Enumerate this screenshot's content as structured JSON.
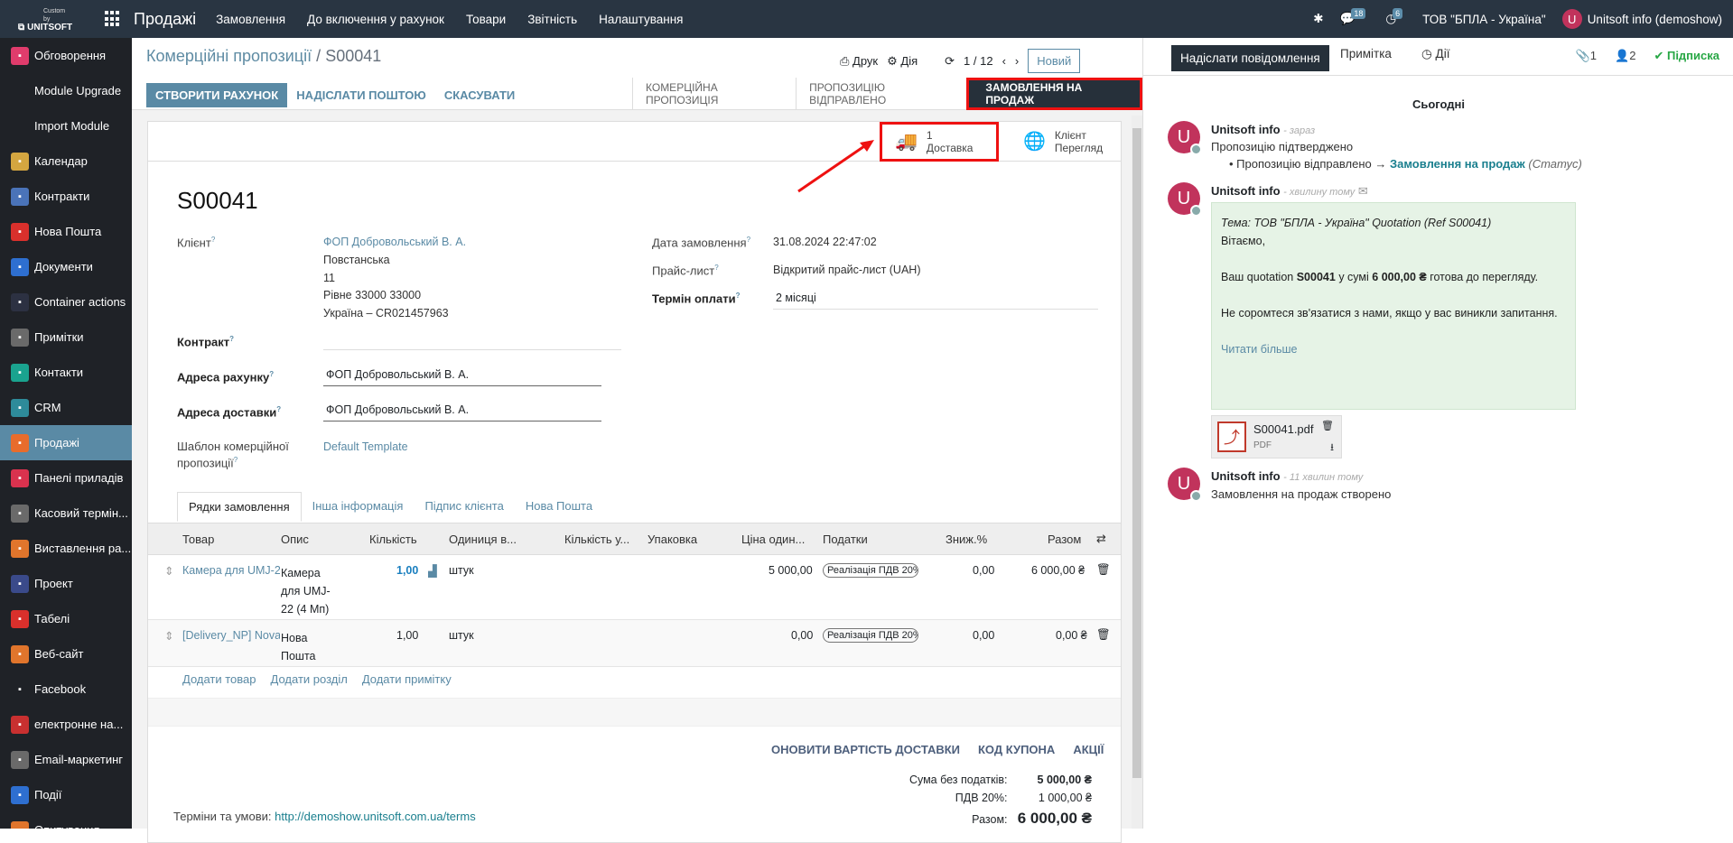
{
  "topbar": {
    "brand_top": "Custom by",
    "brand_name": "UNITSOFT",
    "app_name": "Продажі",
    "menu": [
      "Замовлення",
      "До включення у рахунок",
      "Товари",
      "Звітність",
      "Налаштування"
    ],
    "messages_count": "18",
    "activities_count": "6",
    "company": "ТОВ \"БПЛА - Україна\"",
    "user_initial": "U",
    "user": "Unitsoft info (demoshow)"
  },
  "sidebar": {
    "items": [
      {
        "label": "Обговорення",
        "icon": "chat-icon",
        "color": "#e03c6c"
      },
      {
        "label": "Module Upgrade",
        "icon": "",
        "color": ""
      },
      {
        "label": "Import Module",
        "icon": "",
        "color": ""
      },
      {
        "label": "Календар",
        "icon": "calendar-icon",
        "color": "#d4a640"
      },
      {
        "label": "Контракти",
        "icon": "contract-icon",
        "color": "#4a73b8"
      },
      {
        "label": "Нова Пошта",
        "icon": "nova-poshta-icon",
        "color": "#d9302c"
      },
      {
        "label": "Документи",
        "icon": "documents-icon",
        "color": "#2e6fd0"
      },
      {
        "label": "Container actions",
        "icon": "container-icon",
        "color": "#2c3142"
      },
      {
        "label": "Примітки",
        "icon": "notes-icon",
        "color": "#6a6a6a"
      },
      {
        "label": "Контакти",
        "icon": "contacts-icon",
        "color": "#1aa38f"
      },
      {
        "label": "CRM",
        "icon": "crm-icon",
        "color": "#2e8b9a"
      },
      {
        "label": "Продажі",
        "icon": "sales-icon",
        "color": "#e86c2c"
      },
      {
        "label": "Панелі приладів",
        "icon": "dashboard-icon",
        "color": "#d9324e"
      },
      {
        "label": "Касовий термін...",
        "icon": "pos-icon",
        "color": "#6a6a6a"
      },
      {
        "label": "Виставлення ра...",
        "icon": "invoice-icon",
        "color": "#e0752c"
      },
      {
        "label": "Проект",
        "icon": "project-icon",
        "color": "#3a4a8a"
      },
      {
        "label": "Табелі",
        "icon": "timesheet-icon",
        "color": "#d9302c"
      },
      {
        "label": "Веб-сайт",
        "icon": "website-icon",
        "color": "#e0752c"
      },
      {
        "label": "Facebook",
        "icon": "meta-icon",
        "color": "#1f2227"
      },
      {
        "label": "електронне на...",
        "icon": "elearning-icon",
        "color": "#c83030"
      },
      {
        "label": "Email-маркетинг",
        "icon": "email-marketing-icon",
        "color": "#6a6a6a"
      },
      {
        "label": "Події",
        "icon": "events-icon",
        "color": "#2e6fd0"
      },
      {
        "label": "Опитування",
        "icon": "survey-icon",
        "color": "#e0752c"
      }
    ]
  },
  "controlpanel": {
    "breadcrumb_parent": "Комерційні пропозиції",
    "breadcrumb_sep": "/",
    "breadcrumb_current": "S00041",
    "print_label": "Друк",
    "action_label": "Дія",
    "pager": "1 / 12",
    "new_label": "Новий",
    "btn_invoice": "СТВОРИТИ РАХУНОК",
    "btn_email": "НАДІСЛАТИ ПОШТОЮ",
    "btn_cancel": "СКАСУВАТИ",
    "stages": [
      "КОМЕРЦІЙНА ПРОПОЗИЦІЯ",
      "ПРОПОЗИЦІЮ ВІДПРАВЛЕНО",
      "ЗАМОВЛЕННЯ НА ПРОДАЖ"
    ]
  },
  "smart": {
    "delivery_count": "1",
    "delivery_label": "Доставка",
    "preview_line1": "Клієнт",
    "preview_line2": "Перегляд"
  },
  "form": {
    "name": "S00041",
    "client_label": "Клієнт",
    "client_name": "ФОП Добровольський В. А.",
    "client_addr": [
      "Повстанська",
      "11",
      "Рівне 33000 33000",
      "Україна – CR021457963"
    ],
    "contract_label": "Контракт",
    "invoice_addr_label": "Адреса рахунку",
    "invoice_addr": "ФОП Добровольський В. А.",
    "delivery_addr_label": "Адреса доставки",
    "delivery_addr": "ФОП Добровольський В. А.",
    "template_label_1": "Шаблон комерційної",
    "template_label_2": "пропозиції",
    "template_value": "Default Template",
    "date_label": "Дата замовлення",
    "date_value": "31.08.2024 22:47:02",
    "pricelist_label": "Прайс-лист",
    "pricelist_value": "Відкритий прайс-лист (UAH)",
    "terms_label": "Термін оплати",
    "terms_value": "2 місяці",
    "help_mark": "?"
  },
  "tabs": [
    "Рядки замовлення",
    "Інша інформація",
    "Підпис клієнта",
    "Нова Пошта"
  ],
  "table": {
    "headers": [
      "Товар",
      "Опис",
      "Кількість",
      "Одиниця в...",
      "Кількість у...",
      "Упаковка",
      "Ціна один...",
      "Податки",
      "Зниж.%",
      "Разом"
    ],
    "rows": [
      {
        "product": "Камера для UMJ-2",
        "desc": [
          "Камера",
          "для UMJ-",
          "22 (4 Мп)"
        ],
        "qty": "1,00",
        "uom": "штук",
        "price": "5 000,00",
        "tax": "Реалізація ПДВ 20%",
        "disc": "0,00",
        "total": "6 000,00 ₴"
      },
      {
        "product": "[Delivery_NP] Nova",
        "desc": [
          "Нова",
          "Пошта"
        ],
        "qty": "1,00",
        "uom": "штук",
        "price": "0,00",
        "tax": "Реалізація ПДВ 20%",
        "disc": "0,00",
        "total": "0,00 ₴"
      }
    ],
    "add_links": [
      "Додати товар",
      "Додати розділ",
      "Додати примітку"
    ]
  },
  "footer": {
    "btn_update_delivery": "ОНОВИТИ ВАРТІСТЬ ДОСТАВКИ",
    "btn_coupon": "КОД КУПОНА",
    "btn_promos": "АКЦІЇ",
    "terms_label": "Терміни та умови:",
    "terms_url": "http://demoshow.unitsoft.com.ua/terms",
    "untaxed_label": "Сума без податків:",
    "untaxed_value": "5 000,00 ₴",
    "vat_label": "ПДВ 20%:",
    "vat_value": "1 000,00 ₴",
    "total_label": "Разом:",
    "total_value": "6 000,00 ₴"
  },
  "chatter": {
    "send_message": "Надіслати повідомлення",
    "note": "Примітка",
    "activities": "Дії",
    "attachments_count": "1",
    "followers_count": "2",
    "follow": "Підписка",
    "today": "Сьогодні",
    "msg1": {
      "author": "Unitsoft info",
      "time": "- зараз",
      "text": "Пропозицію підтверджено",
      "change_from": "Пропозицію відправлено",
      "change_to": "Замовлення на продаж",
      "change_field": "(Статус)"
    },
    "msg2": {
      "author": "Unitsoft info",
      "time": "- хвилину тому",
      "subject": "Тема: ТОВ \"БПЛА - Україна\" Quotation (Ref S00041)",
      "greeting": "Вітаємо,",
      "body_pre": "Ваш quotation",
      "body_ref": "S00041",
      "body_mid": "у сумі",
      "body_amount": "6 000,00 ₴",
      "body_post": "готова до перегляду.",
      "body2": "Не соромтеся зв'язатися з нами, якщо у вас виникли запитання.",
      "read_more": "Читати більше",
      "attachment_name": "S00041.pdf",
      "attachment_type": "PDF"
    },
    "msg3": {
      "author": "Unitsoft info",
      "time": "- 11 хвилин тому",
      "text": "Замовлення на продаж створено"
    }
  },
  "colors": {
    "accent": "#5a8aa5",
    "highlight": "#e11111",
    "navbar": "#293542"
  }
}
